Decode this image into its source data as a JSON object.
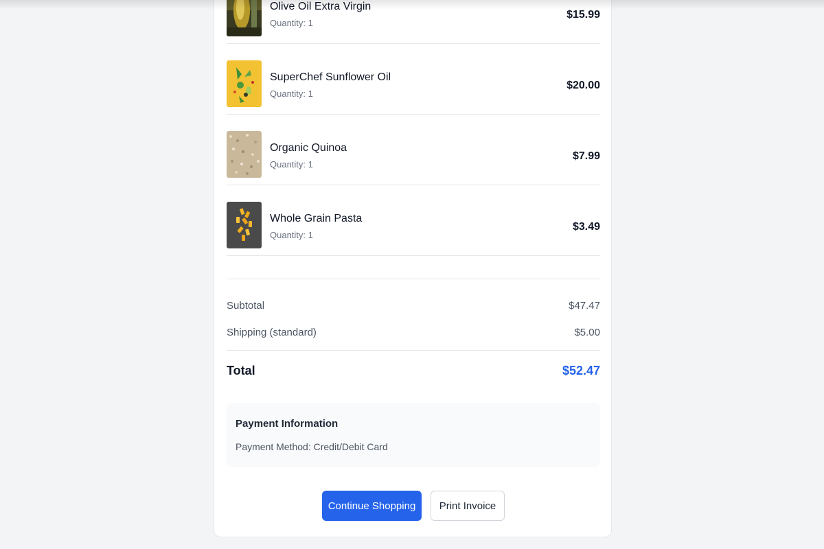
{
  "order_items": [
    {
      "name": "Olive Oil Extra Virgin",
      "quantity": "Quantity: 1",
      "price": "$15.99",
      "image": "olive-oil-image"
    },
    {
      "name": "SuperChef Sunflower Oil",
      "quantity": "Quantity: 1",
      "price": "$20.00",
      "image": "sunflower-oil-image"
    },
    {
      "name": "Organic Quinoa",
      "quantity": "Quantity: 1",
      "price": "$7.99",
      "image": "quinoa-image"
    },
    {
      "name": "Whole Grain Pasta",
      "quantity": "Quantity: 1",
      "price": "$3.49",
      "image": "pasta-image"
    }
  ],
  "summary": {
    "subtotal_label": "Subtotal",
    "subtotal_value": "$47.47",
    "shipping_label": "Shipping (standard)",
    "shipping_value": "$5.00",
    "total_label": "Total",
    "total_value": "$52.47"
  },
  "payment": {
    "title": "Payment Information",
    "method": "Payment Method: Credit/Debit Card"
  },
  "actions": {
    "continue_label": "Continue Shopping",
    "print_label": "Print Invoice"
  },
  "colors": {
    "accent": "#2563eb",
    "background": "#f3f4f6",
    "card": "#ffffff"
  }
}
